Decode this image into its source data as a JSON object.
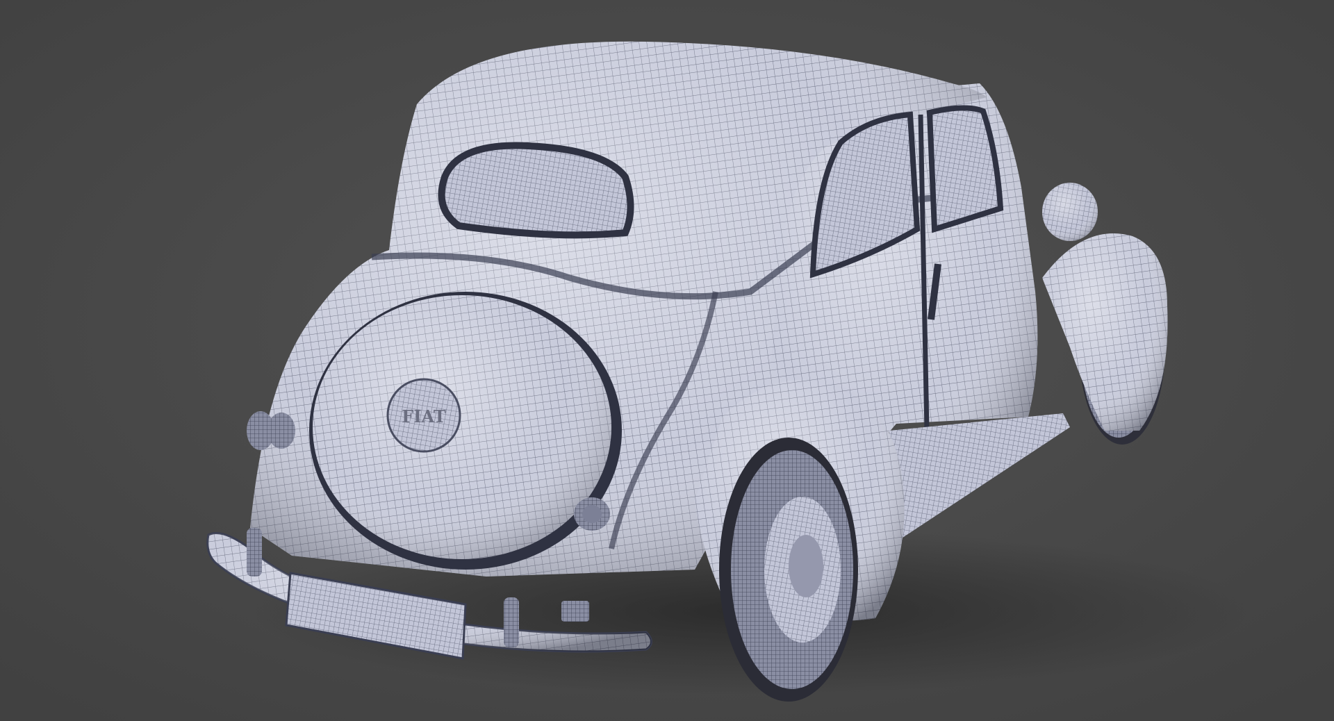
{
  "scene": {
    "subject": "car-wireframe-render",
    "background_color": "#4a4a4a",
    "body_color": "#c9ccdc",
    "wire_color": "#3d4152",
    "shadow_color": "#2f2f30"
  },
  "emblem": {
    "text": "FIAT"
  },
  "license_plate": {
    "text": ""
  }
}
